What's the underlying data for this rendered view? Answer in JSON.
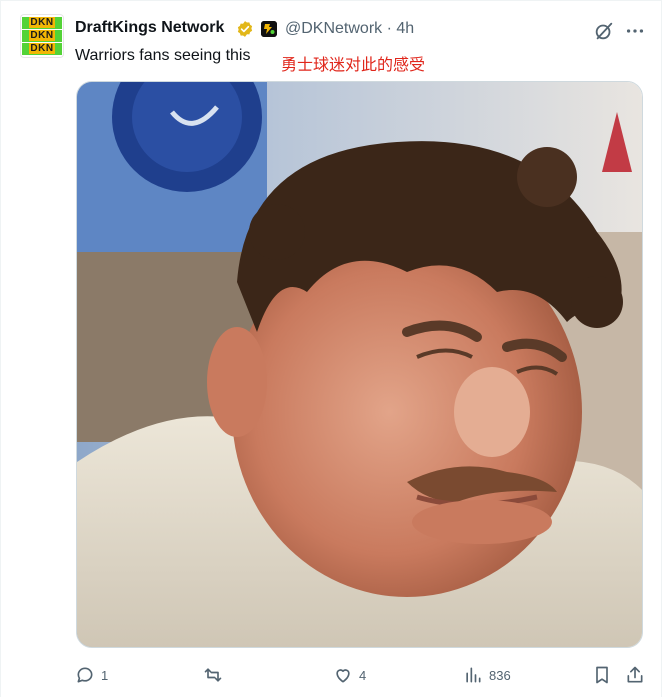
{
  "author": {
    "display_name": "DraftKings Network",
    "handle": "@DKNetwork",
    "separator": "·",
    "time": "4h",
    "avatar_lines": [
      "DKN",
      "DKN",
      "DKN"
    ]
  },
  "post": {
    "text": "Warriors fans seeing this",
    "overlay_caption": "勇士球迷对此的感受"
  },
  "media": {
    "description_icon": "photo"
  },
  "actions": {
    "reply_count": "1",
    "retweet_count": "",
    "like_count": "4",
    "views_count": "836"
  },
  "colors": {
    "text_primary": "#0f1419",
    "text_secondary": "#536471",
    "verified_gold": "#e2b719",
    "caption_red": "#e0261b",
    "avatar_green": "#53d337",
    "avatar_yellow": "#f2b705"
  },
  "icons": [
    "verified-badge-icon",
    "affiliate-badge-icon",
    "grok-icon",
    "more-icon",
    "reply-icon",
    "retweet-icon",
    "like-icon",
    "views-icon",
    "bookmark-icon",
    "share-icon"
  ]
}
